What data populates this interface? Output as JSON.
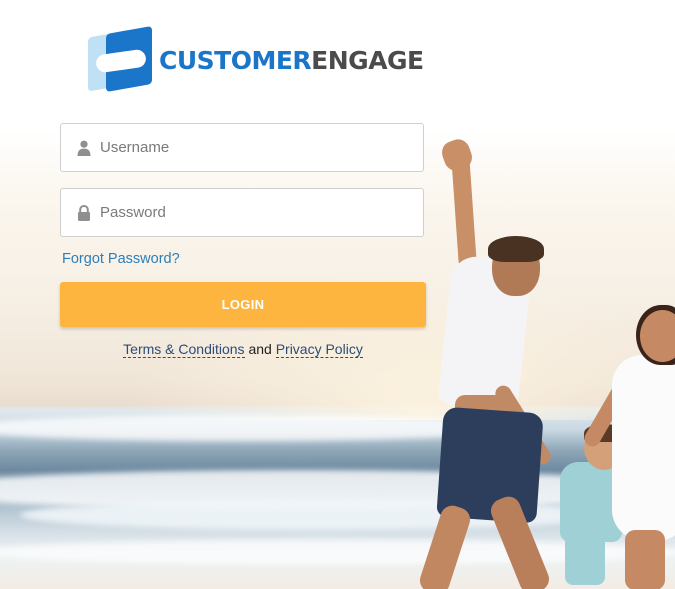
{
  "brand": {
    "name_part1": "CUSTOMER",
    "name_part2": "ENGAGE",
    "primary_color": "#1b76c9",
    "secondary_color": "#4b4b4b",
    "logo_icon": "handshake-icon"
  },
  "login_form": {
    "username": {
      "placeholder": "Username",
      "value": "",
      "icon": "user-icon"
    },
    "password": {
      "placeholder": "Password",
      "value": "",
      "icon": "lock-icon"
    },
    "forgot_password_label": "Forgot Password?",
    "submit_label": "LOGIN",
    "submit_color": "#fdb540"
  },
  "legal": {
    "terms_label": "Terms & Conditions",
    "conjunction": "and",
    "privacy_label": "Privacy Policy"
  }
}
